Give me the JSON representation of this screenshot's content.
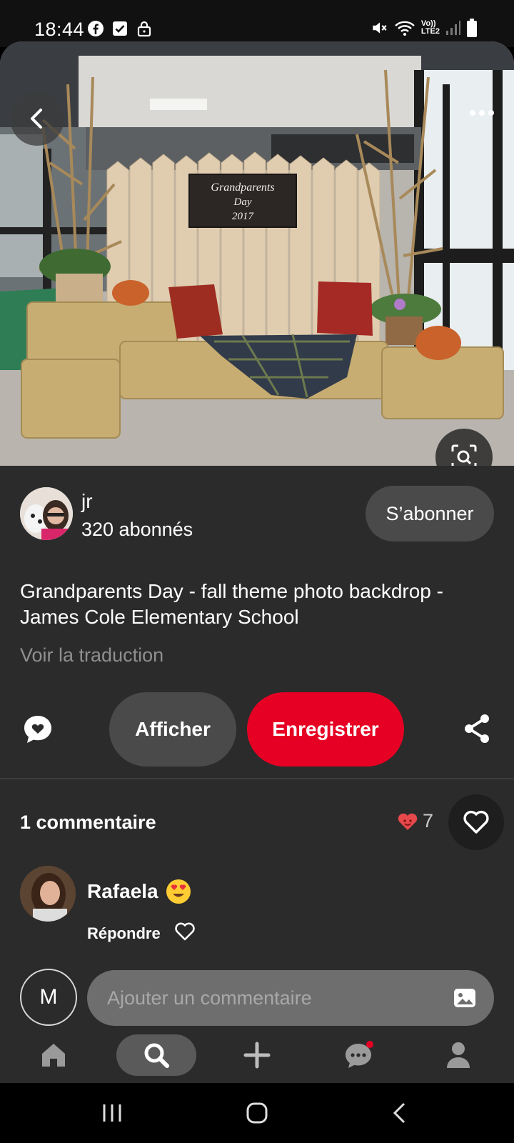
{
  "status_bar": {
    "time": "18:44",
    "left_icons": [
      "facebook-icon",
      "checkbox-icon",
      "lock-icon"
    ],
    "right_icons": [
      "mute-icon",
      "wifi-icon",
      "lte-icon",
      "signal-icon",
      "battery-icon"
    ],
    "network_label_top": "Vo))",
    "network_label_bottom": "LTE2"
  },
  "photo": {
    "sign_line1": "Grandparents",
    "sign_line2": "Day",
    "sign_line3": "2017"
  },
  "author": {
    "name": "jr",
    "followers": "320 abonnés",
    "follow_label": "S’abonner"
  },
  "pin": {
    "title": "Grandparents Day - fall theme photo backdrop - James Cole Elementary School",
    "translate_label": "Voir la traduction"
  },
  "actions": {
    "view_label": "Afficher",
    "save_label": "Enregistrer"
  },
  "comments": {
    "count_label": "1 commentaire",
    "reaction_count": "7",
    "items": [
      {
        "author": "Rafaela",
        "reply_label": "Répondre"
      }
    ],
    "me_initial": "M",
    "input_placeholder": "Ajouter un commentaire"
  },
  "bottom_nav": [
    "home-icon",
    "search-icon",
    "add-icon",
    "messages-icon",
    "profile-icon"
  ],
  "colors": {
    "accent": "#e60023",
    "panel": "#2b2b2b",
    "pill": "#4a4a4a"
  }
}
